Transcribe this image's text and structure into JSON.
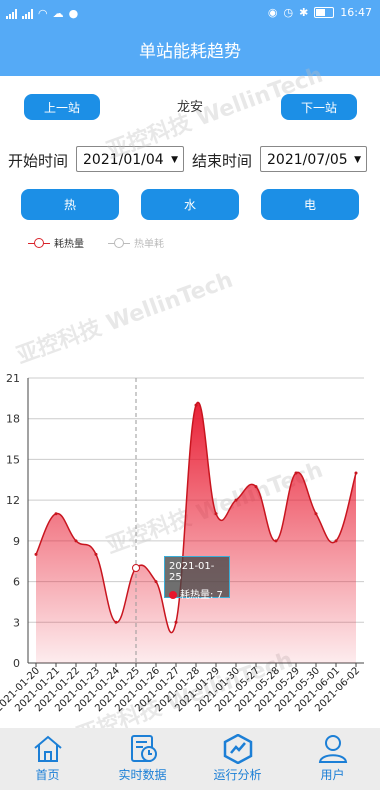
{
  "status": {
    "time": "16:47"
  },
  "header": {
    "title": "单站能耗趋势"
  },
  "nav": {
    "prev_label": "上一站",
    "station": "龙安",
    "next_label": "下一站"
  },
  "filters": {
    "start_label": "开始时间",
    "start_value": "2021/01/04",
    "end_label": "结束时间",
    "end_value": "2021/07/05"
  },
  "types": {
    "heat": "热",
    "water": "水",
    "electric": "电"
  },
  "legend": {
    "series1": "耗热量",
    "series2": "热单耗"
  },
  "watermark": "亚控科技 WellinTech",
  "tooltip": {
    "date": "2021-01-25",
    "label": "耗热量: 7"
  },
  "tabs": {
    "home": "首页",
    "realtime": "实时数据",
    "analysis": "运行分析",
    "user": "用户"
  },
  "colors": {
    "accent": "#55aaf6",
    "button": "#1c8fe6",
    "series": "#e8162c"
  },
  "chart_data": {
    "type": "area",
    "x": [
      "2021-01-20",
      "2021-01-21",
      "2021-01-22",
      "2021-01-23",
      "2021-01-24",
      "2021-01-25",
      "2021-01-26",
      "2021-01-27",
      "2021-01-28",
      "2021-01-29",
      "2021-01-30",
      "2021-05-27",
      "2021-05-28",
      "2021-05-29",
      "2021-05-30",
      "2021-06-01",
      "2021-06-02"
    ],
    "series": [
      {
        "name": "耗热量",
        "values": [
          8,
          11,
          9,
          8,
          3,
          7,
          6,
          3,
          19,
          11,
          12,
          13,
          9,
          14,
          11,
          9,
          14
        ]
      }
    ],
    "ylim": [
      0,
      21
    ],
    "yticks": [
      0,
      3,
      6,
      9,
      12,
      15,
      18,
      21
    ],
    "grid": true,
    "highlight_index": 5
  }
}
